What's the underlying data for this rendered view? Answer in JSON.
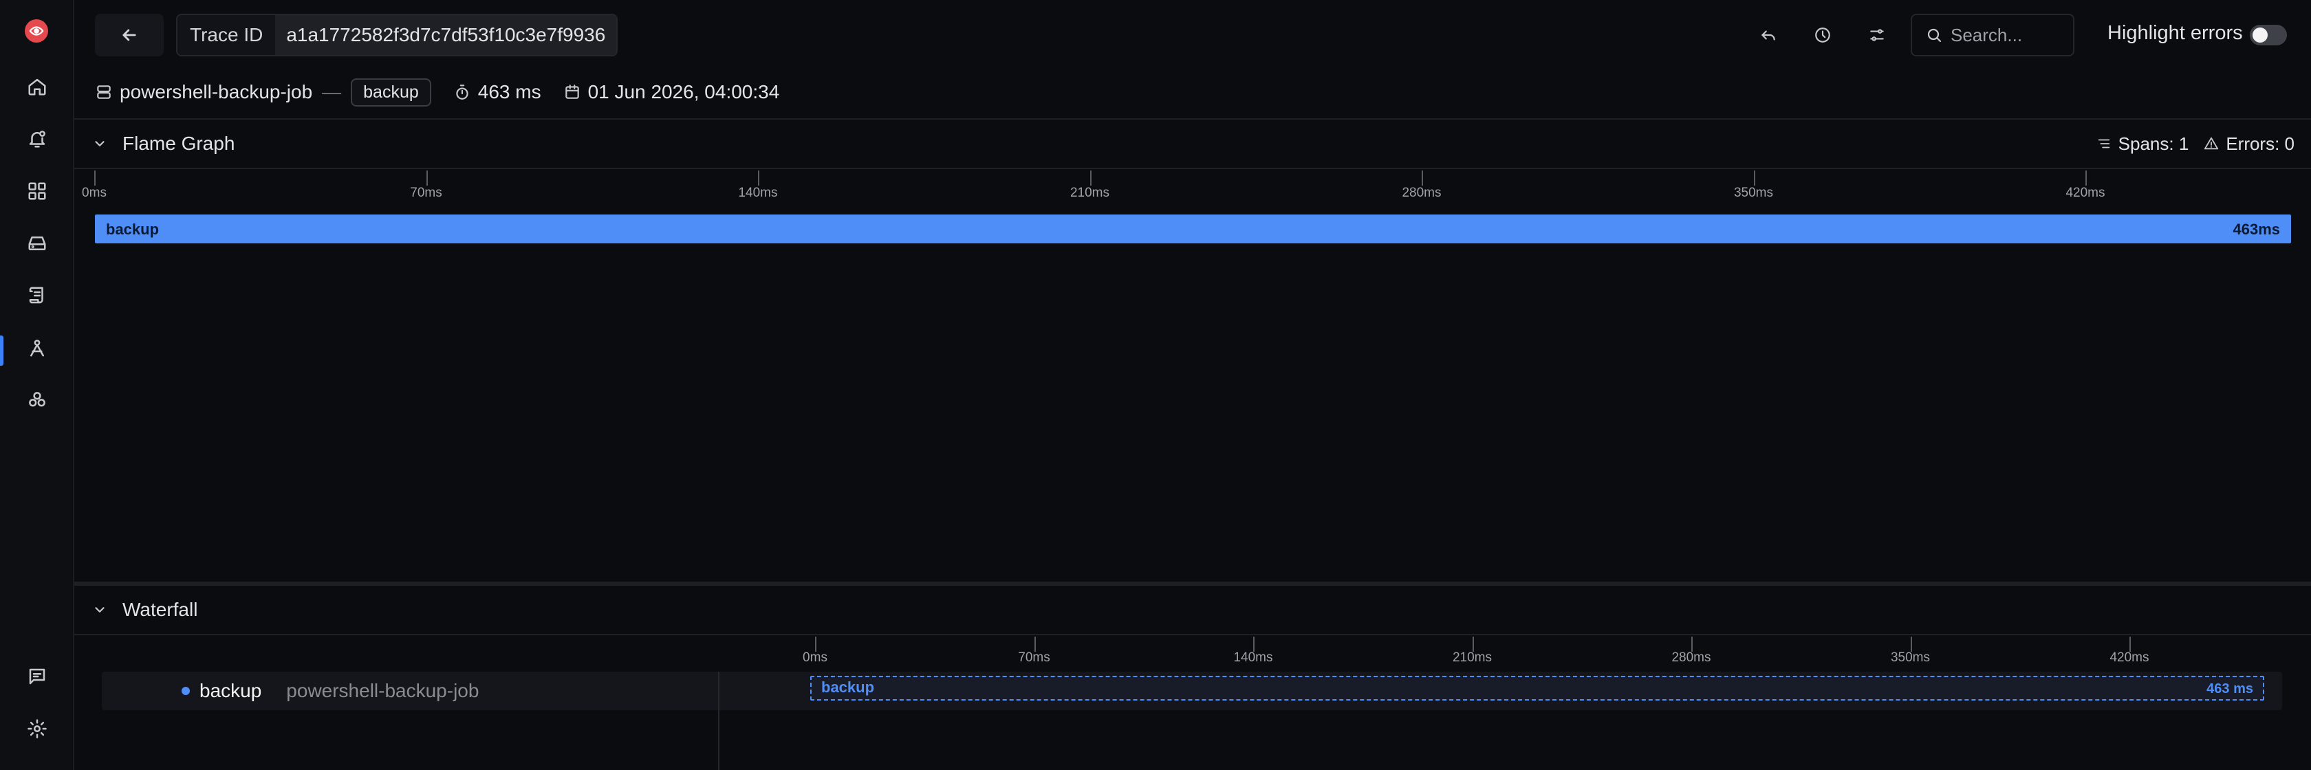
{
  "sidebar": {
    "logo_icon": "eye-icon",
    "items": [
      {
        "icon": "home-icon"
      },
      {
        "icon": "alerts-bell-icon"
      },
      {
        "icon": "dashboards-grid-icon"
      },
      {
        "icon": "storage-drive-icon"
      },
      {
        "icon": "logs-scroll-icon"
      },
      {
        "icon": "traces-icon",
        "active": true
      },
      {
        "icon": "services-cluster-icon"
      }
    ],
    "bottom": [
      {
        "icon": "feedback-message-icon"
      },
      {
        "icon": "settings-gear-icon"
      }
    ]
  },
  "header": {
    "trace_id_label": "Trace ID",
    "trace_id_value": "a1a1772582f3d7c7df53f10c3e7f9936",
    "search_placeholder": "Search...",
    "highlight_errors_label": "Highlight errors",
    "highlight_errors_on": false
  },
  "info": {
    "service": "powershell-backup-job",
    "separator": "—",
    "operation": "backup",
    "duration": "463 ms",
    "timestamp": "01 Jun 2026, 04:00:34"
  },
  "flame": {
    "title": "Flame Graph",
    "spans_stat": "Spans: 1",
    "errors_stat": "Errors: 0",
    "ticks": [
      "0ms",
      "70ms",
      "140ms",
      "210ms",
      "280ms",
      "350ms",
      "420ms"
    ],
    "span_name": "backup",
    "span_duration": "463ms"
  },
  "waterfall": {
    "title": "Waterfall",
    "ticks": [
      "0ms",
      "70ms",
      "140ms",
      "210ms",
      "280ms",
      "350ms",
      "420ms"
    ],
    "row": {
      "name": "backup",
      "service": "powershell-backup-job",
      "bar_name": "backup",
      "bar_duration": "463 ms"
    }
  },
  "colors": {
    "accent": "#4f8ef7",
    "active_indicator": "#3b82f6",
    "logo": "#e5484d"
  }
}
